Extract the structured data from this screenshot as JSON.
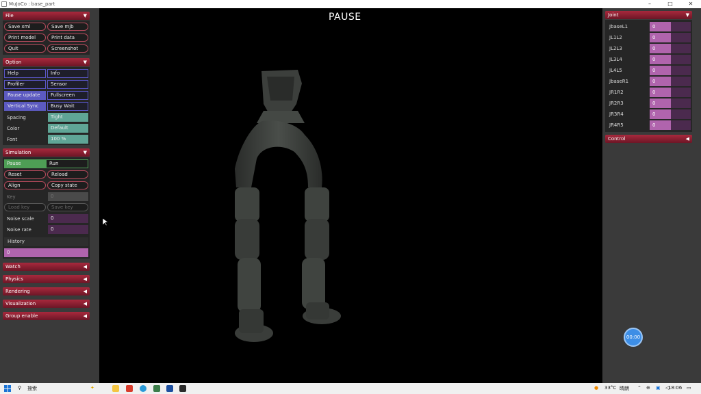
{
  "window": {
    "title": "MuJoCo : base_part",
    "controls": [
      "–",
      "□",
      "✕"
    ]
  },
  "viewport": {
    "status": "PAUSE"
  },
  "file": {
    "header": "File",
    "buttons": [
      "Save xml",
      "Save mjb",
      "Print model",
      "Print data",
      "Quit",
      "Screenshot"
    ]
  },
  "option": {
    "header": "Option",
    "toggles": [
      "Help",
      "Info",
      "Profiler",
      "Sensor",
      "Pause update",
      "Fullscreen",
      "Vertical Sync",
      "Busy Wait"
    ],
    "spacing_label": "Spacing",
    "spacing_value": "Tight",
    "color_label": "Color",
    "color_value": "Default",
    "font_label": "Font",
    "font_value": "100 %"
  },
  "simulation": {
    "header": "Simulation",
    "pause": "Pause",
    "run": "Run",
    "reset": "Reset",
    "reload": "Reload",
    "align": "Align",
    "copy_state": "Copy state",
    "key_label": "Key",
    "key_value": "0",
    "load_key": "Load key",
    "save_key": "Save key",
    "noise_scale_label": "Noise scale",
    "noise_scale_value": "0",
    "noise_rate_label": "Noise rate",
    "noise_rate_value": "0",
    "history_label": "History",
    "history_value": "0"
  },
  "collapsed_sections": [
    "Watch",
    "Physics",
    "Rendering",
    "Visualization",
    "Group enable"
  ],
  "joint": {
    "header": "Joint",
    "rows": [
      {
        "name": "JbaseL1",
        "value": "0"
      },
      {
        "name": "JL1L2",
        "value": "0"
      },
      {
        "name": "JL2L3",
        "value": "0"
      },
      {
        "name": "JL3L4",
        "value": "0"
      },
      {
        "name": "JL4L5",
        "value": "0"
      },
      {
        "name": "JbaseR1",
        "value": "0"
      },
      {
        "name": "JR1R2",
        "value": "0"
      },
      {
        "name": "JR2R3",
        "value": "0"
      },
      {
        "name": "JR3R4",
        "value": "0"
      },
      {
        "name": "JR4R5",
        "value": "0"
      }
    ]
  },
  "control": {
    "header": "Control"
  },
  "overlay": {
    "timer": "00:00"
  },
  "taskbar": {
    "search": "搜索",
    "temperature": "33°C",
    "weather": "晴朗",
    "time": "18:06"
  },
  "colors": {
    "section_header": "#8e2234",
    "toggle_on": "#5c5ac0",
    "teal_field": "#5fa596",
    "slider_bg": "#4b2a4e",
    "slider_fill": "#b064ad",
    "pause_green": "#4e9e55"
  }
}
